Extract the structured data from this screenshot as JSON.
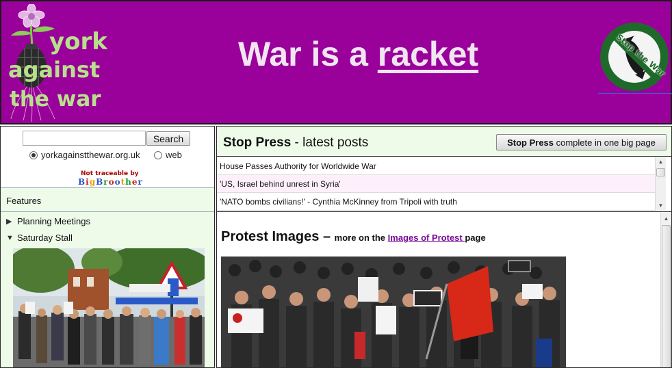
{
  "header": {
    "logo": {
      "line1": "york",
      "line2": "against",
      "line3": "the war"
    },
    "banner_prefix": "War is a ",
    "banner_link": "racket",
    "badge_text": "Stop the War"
  },
  "sidebar": {
    "search": {
      "input_value": "",
      "button_label": "Search",
      "radio_site": "yorkagainstthewar.org.uk",
      "radio_web": "web"
    },
    "not_traceable": "Not traceable by",
    "bigbrother": "BigBrother",
    "features_label": "Features",
    "items": [
      {
        "label": "Planning Meetings",
        "expanded": false
      },
      {
        "label": "Saturday Stall",
        "expanded": true
      }
    ]
  },
  "stop_press": {
    "title_bold": "Stop Press",
    "title_rest": " - latest posts",
    "button_bold": "Stop Press",
    "button_rest": " complete in one big page",
    "posts": [
      "House Passes Authority for Worldwide War",
      "'US, Israel behind unrest in Syria'",
      "'NATO bombs civilians!' - Cynthia McKinney from Tripoli with truth"
    ]
  },
  "protest": {
    "heading": "Protest Images",
    "dash": " – ",
    "more_prefix": "more on the ",
    "link": "Images of Protest ",
    "more_suffix": "page"
  },
  "colors": {
    "header_bg": "#9a009a",
    "panel_bg": "#eefbe9",
    "link_purple": "#7a0a9a"
  }
}
